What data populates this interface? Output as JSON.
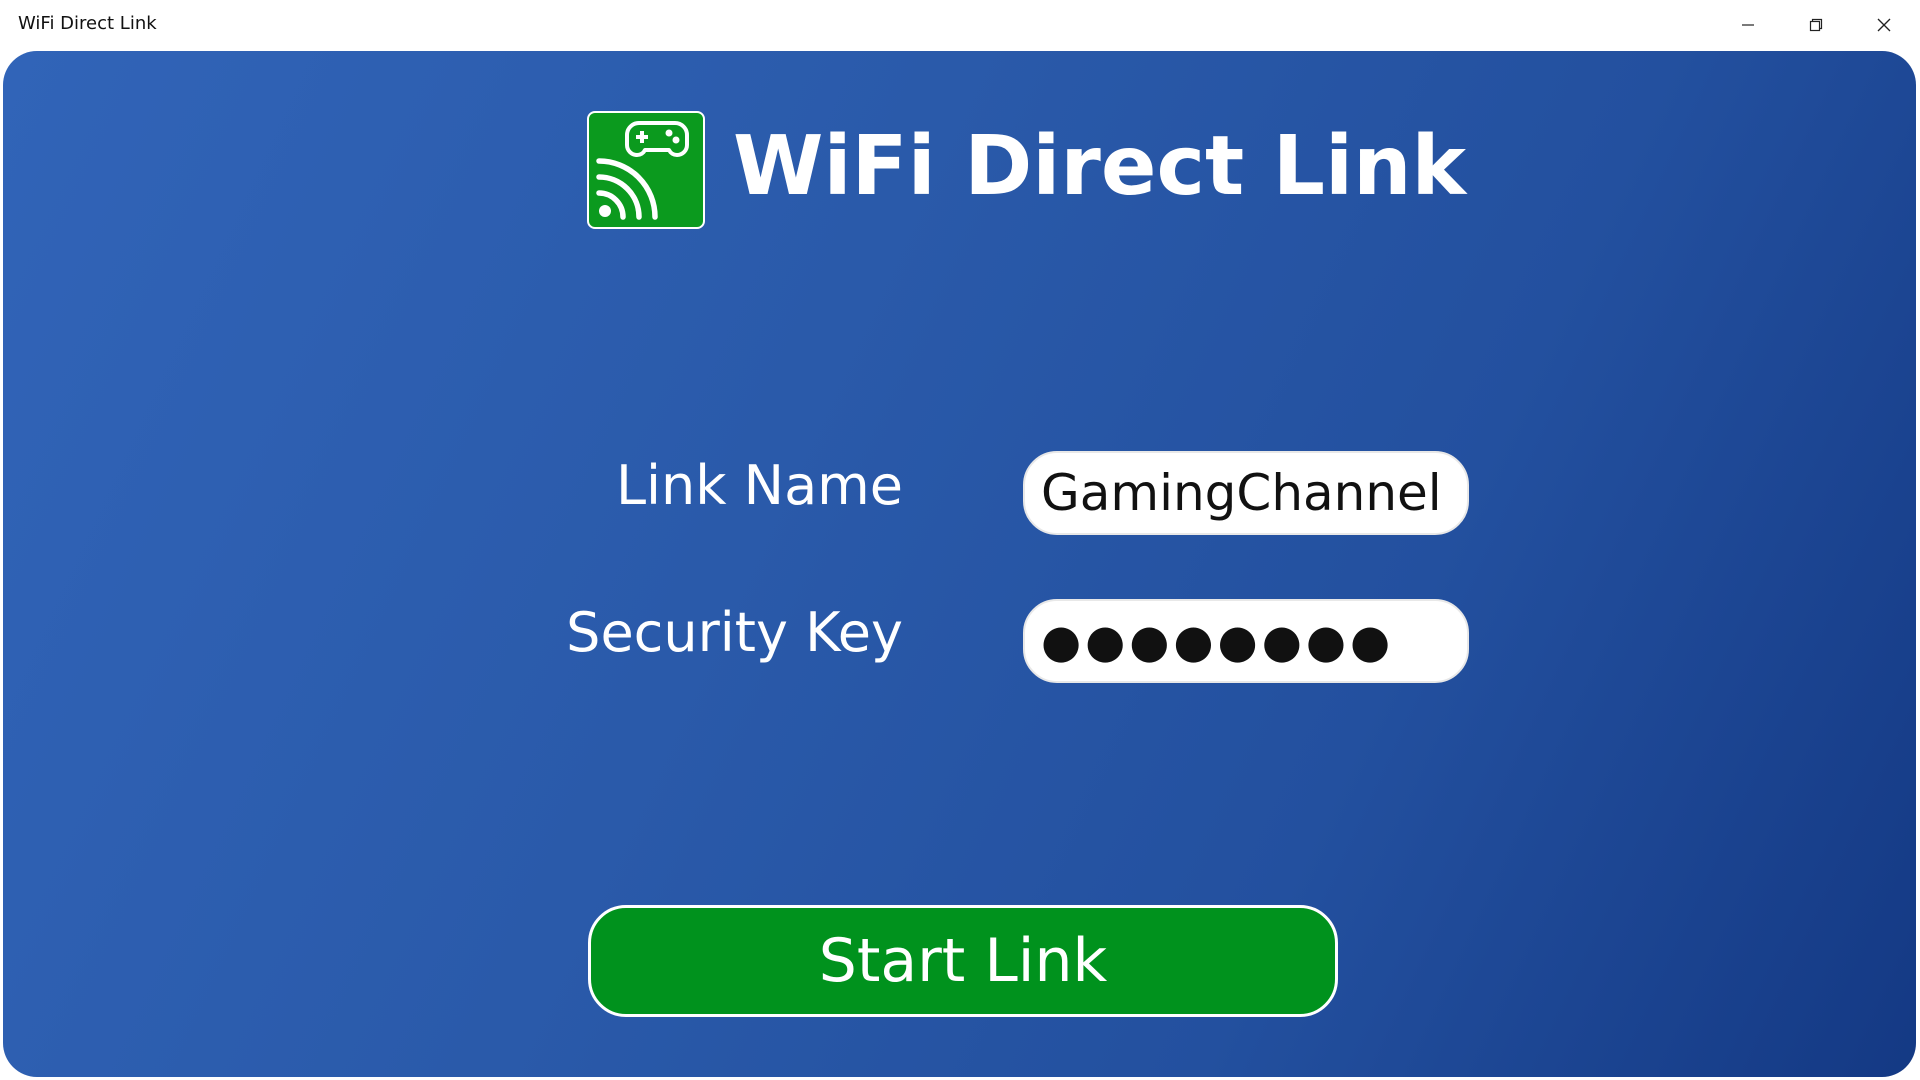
{
  "window": {
    "title": "WiFi Direct Link",
    "controls": {
      "minimize_icon": "minimize-icon",
      "maximize_icon": "restore-icon",
      "close_icon": "close-icon"
    }
  },
  "header": {
    "app_title": "WiFi Direct Link",
    "logo_icon": "gamepad-wifi-logo-icon"
  },
  "form": {
    "link_name": {
      "label": "Link Name",
      "value": "GamingChannel"
    },
    "security_key": {
      "label": "Security Key",
      "value": "●●●●●●●●"
    }
  },
  "actions": {
    "start_label": "Start Link"
  },
  "colors": {
    "background_start": "#3164b8",
    "background_end": "#143984",
    "accent_green": "#00921d",
    "logo_green": "#0b9a1e",
    "text_light": "#ffffff"
  }
}
